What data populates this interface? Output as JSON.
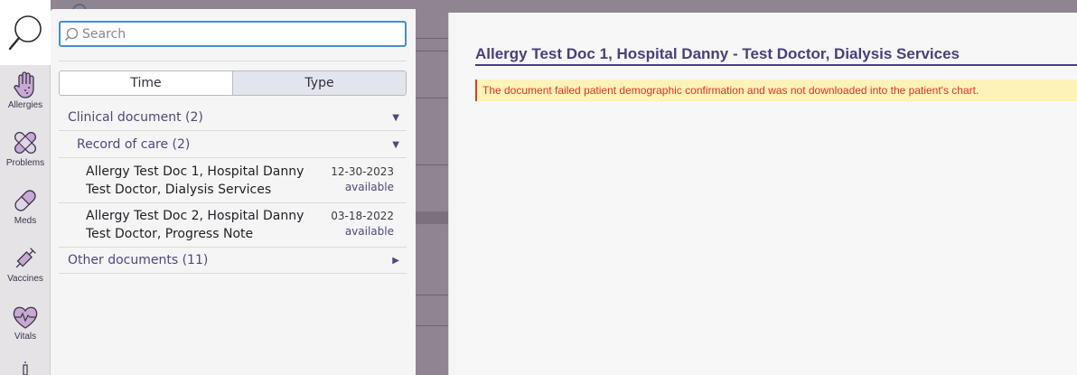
{
  "search": {
    "placeholder": "Search",
    "value": ""
  },
  "sidebar": {
    "items": [
      {
        "label": "Allergies",
        "icon": "allergies-hand-icon"
      },
      {
        "label": "Problems",
        "icon": "bandage-icon"
      },
      {
        "label": "Meds",
        "icon": "pill-icon"
      },
      {
        "label": "Vaccines",
        "icon": "syringe-icon"
      },
      {
        "label": "Vitals",
        "icon": "heart-pulse-icon"
      }
    ]
  },
  "filter": {
    "tabs": [
      {
        "label": "Time",
        "selected": false
      },
      {
        "label": "Type",
        "selected": true
      }
    ]
  },
  "tree": {
    "clinical": {
      "label": "Clinical document (2)",
      "expanded": true
    },
    "record": {
      "label": "Record of care (2)",
      "expanded": true
    },
    "documents": [
      {
        "title": "Allergy Test Doc 1, Hospital Danny",
        "subtitle": "Test Doctor, Dialysis Services",
        "date": "12-30-2023",
        "status": "available"
      },
      {
        "title": "Allergy Test Doc 2, Hospital Danny",
        "subtitle": "Test Doctor, Progress Note",
        "date": "03-18-2022",
        "status": "available"
      }
    ],
    "other": {
      "label": "Other documents (11)",
      "expanded": false
    }
  },
  "document": {
    "title": "Allergy Test Doc 1, Hospital Danny - Test Doctor, Dialysis Services",
    "alert": "The document failed patient demographic confirmation and was not downloaded into the patient's chart."
  },
  "colors": {
    "accent": "#4b3f7a",
    "alert_text": "#d9361e",
    "alert_bg": "#fdf3b8",
    "focus": "#4a90c2"
  }
}
